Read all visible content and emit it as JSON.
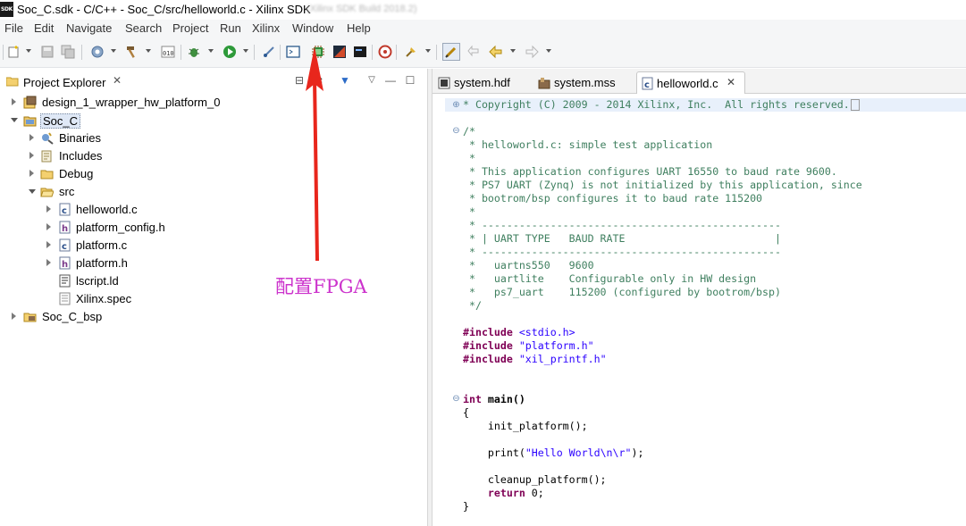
{
  "window": {
    "logo": "SDK",
    "title": "Soc_C.sdk - C/C++ - Soc_C/src/helloworld.c - Xilinx SDK",
    "title_ghost": "(Xilinx SDK Build 2018.2)"
  },
  "menu": [
    "File",
    "Edit",
    "Navigate",
    "Search",
    "Project",
    "Run",
    "Xilinx",
    "Window",
    "Help"
  ],
  "toolbar": {
    "icons": [
      "new-icon",
      "save-icon",
      "save-all-icon",
      "build-icon",
      "hammer-icon",
      "binary-icon",
      "debug-icon",
      "run-icon",
      "skip-icon",
      "terminal-icon",
      "program-fpga-icon",
      "sdk-icon",
      "console-icon",
      "target-icon",
      "pin-icon",
      "annotation-icon",
      "back-icon",
      "forward-icon"
    ]
  },
  "project_explorer": {
    "tab_label": "Project Explorer",
    "items": [
      {
        "label": "design_1_wrapper_hw_platform_0",
        "depth": 0,
        "expanded": false,
        "icon": "hw-platform-icon"
      },
      {
        "label": "Soc_C",
        "depth": 0,
        "expanded": true,
        "icon": "project-folder-icon",
        "selected": true
      },
      {
        "label": "Binaries",
        "depth": 1,
        "expanded": false,
        "icon": "binaries-icon"
      },
      {
        "label": "Includes",
        "depth": 1,
        "expanded": false,
        "icon": "includes-icon"
      },
      {
        "label": "Debug",
        "depth": 1,
        "expanded": false,
        "icon": "folder-icon"
      },
      {
        "label": "src",
        "depth": 1,
        "expanded": true,
        "icon": "folder-icon"
      },
      {
        "label": "helloworld.c",
        "depth": 2,
        "expanded": false,
        "icon": "c-file-icon"
      },
      {
        "label": "platform_config.h",
        "depth": 2,
        "expanded": false,
        "icon": "h-file-icon"
      },
      {
        "label": "platform.c",
        "depth": 2,
        "expanded": false,
        "icon": "c-file-icon"
      },
      {
        "label": "platform.h",
        "depth": 2,
        "expanded": false,
        "icon": "h-file-icon"
      },
      {
        "label": "lscript.ld",
        "depth": 2,
        "expanded": null,
        "icon": "linker-script-icon"
      },
      {
        "label": "Xilinx.spec",
        "depth": 2,
        "expanded": null,
        "icon": "spec-file-icon"
      },
      {
        "label": "Soc_C_bsp",
        "depth": 0,
        "expanded": false,
        "icon": "bsp-folder-icon"
      }
    ]
  },
  "editor": {
    "tabs": [
      {
        "label": "system.hdf",
        "active": false
      },
      {
        "label": "system.mss",
        "active": false
      },
      {
        "label": "helloworld.c",
        "active": true
      }
    ],
    "code": {
      "copyright": "* Copyright (C) 2009 - 2014 Xilinx, Inc.  All rights reserved.",
      "c1": "/*",
      "c2": " * helloworld.c: simple test application",
      "c3": " *",
      "c4": " * This application configures UART 16550 to baud rate 9600.",
      "c5": " * PS7 UART (Zynq) is not initialized by this application, since",
      "c6": " * bootrom/bsp configures it to baud rate 115200",
      "c7": " *",
      "c8": " * ------------------------------------------------",
      "c9": " * | UART TYPE   BAUD RATE                        |",
      "c10": " * ------------------------------------------------",
      "c11": " *   uartns550   9600",
      "c12": " *   uartlite    Configurable only in HW design",
      "c13": " *   ps7_uart    115200 (configured by bootrom/bsp)",
      "c14": " */",
      "inc_kw": "#include",
      "inc1": " <stdio.h>",
      "inc2": " \"platform.h\"",
      "inc3": " \"xil_printf.h\"",
      "main_kw": "int",
      "main_rest": " main()",
      "brace_open": "{",
      "l1": "    init_platform();",
      "l2_a": "    print(",
      "l2_s": "\"Hello World\\n\\r\"",
      "l2_b": ");",
      "l3": "    cleanup_platform();",
      "ret_kw": "return",
      "ret_rest": " 0;",
      "brace_close": "}"
    }
  },
  "annotation": {
    "text": "配置FPGA",
    "color": "#cc33cc",
    "arrow_color": "#e8261c"
  }
}
